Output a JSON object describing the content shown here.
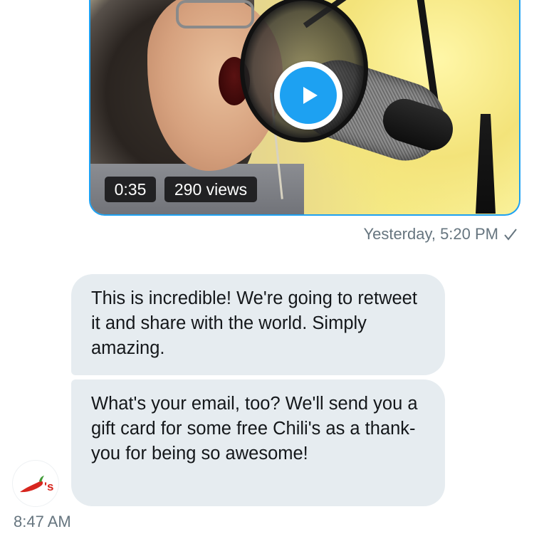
{
  "video_message": {
    "duration": "0:35",
    "views": "290 views",
    "timestamp": "Yesterday, 5:20 PM",
    "status_icon": "checkmark-icon",
    "play_icon": "play-icon"
  },
  "received_messages": [
    {
      "text": "This is incredible! We're going to retweet it and share with the world. Simply amazing."
    },
    {
      "text": "What's your email, too? We'll send you a gift card for some free Chili's as a thank-you for being so awesome!"
    }
  ],
  "sender": {
    "avatar_icon": "chilis-logo-icon",
    "timestamp": "8:47 AM"
  },
  "colors": {
    "accent": "#1da1f2",
    "bubble": "#e6ecf0",
    "meta_text": "#66757f",
    "text": "#14171a",
    "logo_red": "#d7261e",
    "logo_green": "#3f9a36"
  }
}
